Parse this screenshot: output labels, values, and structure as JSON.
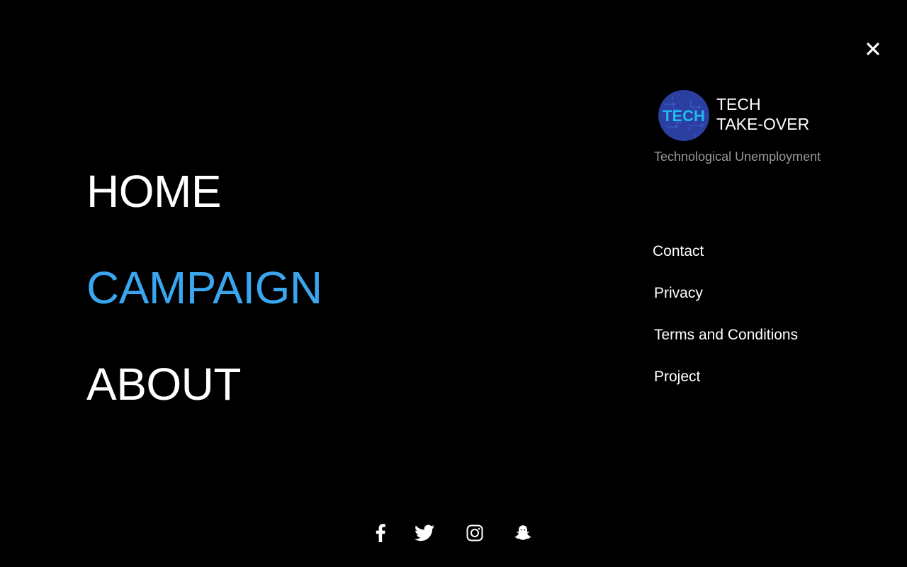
{
  "main_nav": {
    "items": [
      {
        "label": "HOME",
        "active": false
      },
      {
        "label": "CAMPAIGN",
        "active": true
      },
      {
        "label": "ABOUT",
        "active": false
      }
    ]
  },
  "brand": {
    "logo_text": "TECH",
    "title_line1": "TECH",
    "title_line2": "TAKE-OVER",
    "tagline": "Technological Unemployment"
  },
  "secondary_nav": {
    "items": [
      {
        "label": "Contact"
      },
      {
        "label": "Privacy"
      },
      {
        "label": "Terms and Conditions"
      },
      {
        "label": "Project"
      }
    ]
  },
  "social": {
    "icons": [
      "facebook-icon",
      "twitter-icon",
      "instagram-icon",
      "snapchat-icon"
    ]
  },
  "colors": {
    "background": "#000000",
    "text": "#ffffff",
    "accent": "#3aa6ef",
    "muted": "#9a9a9a",
    "logo_bg": "#2a3fa0"
  }
}
